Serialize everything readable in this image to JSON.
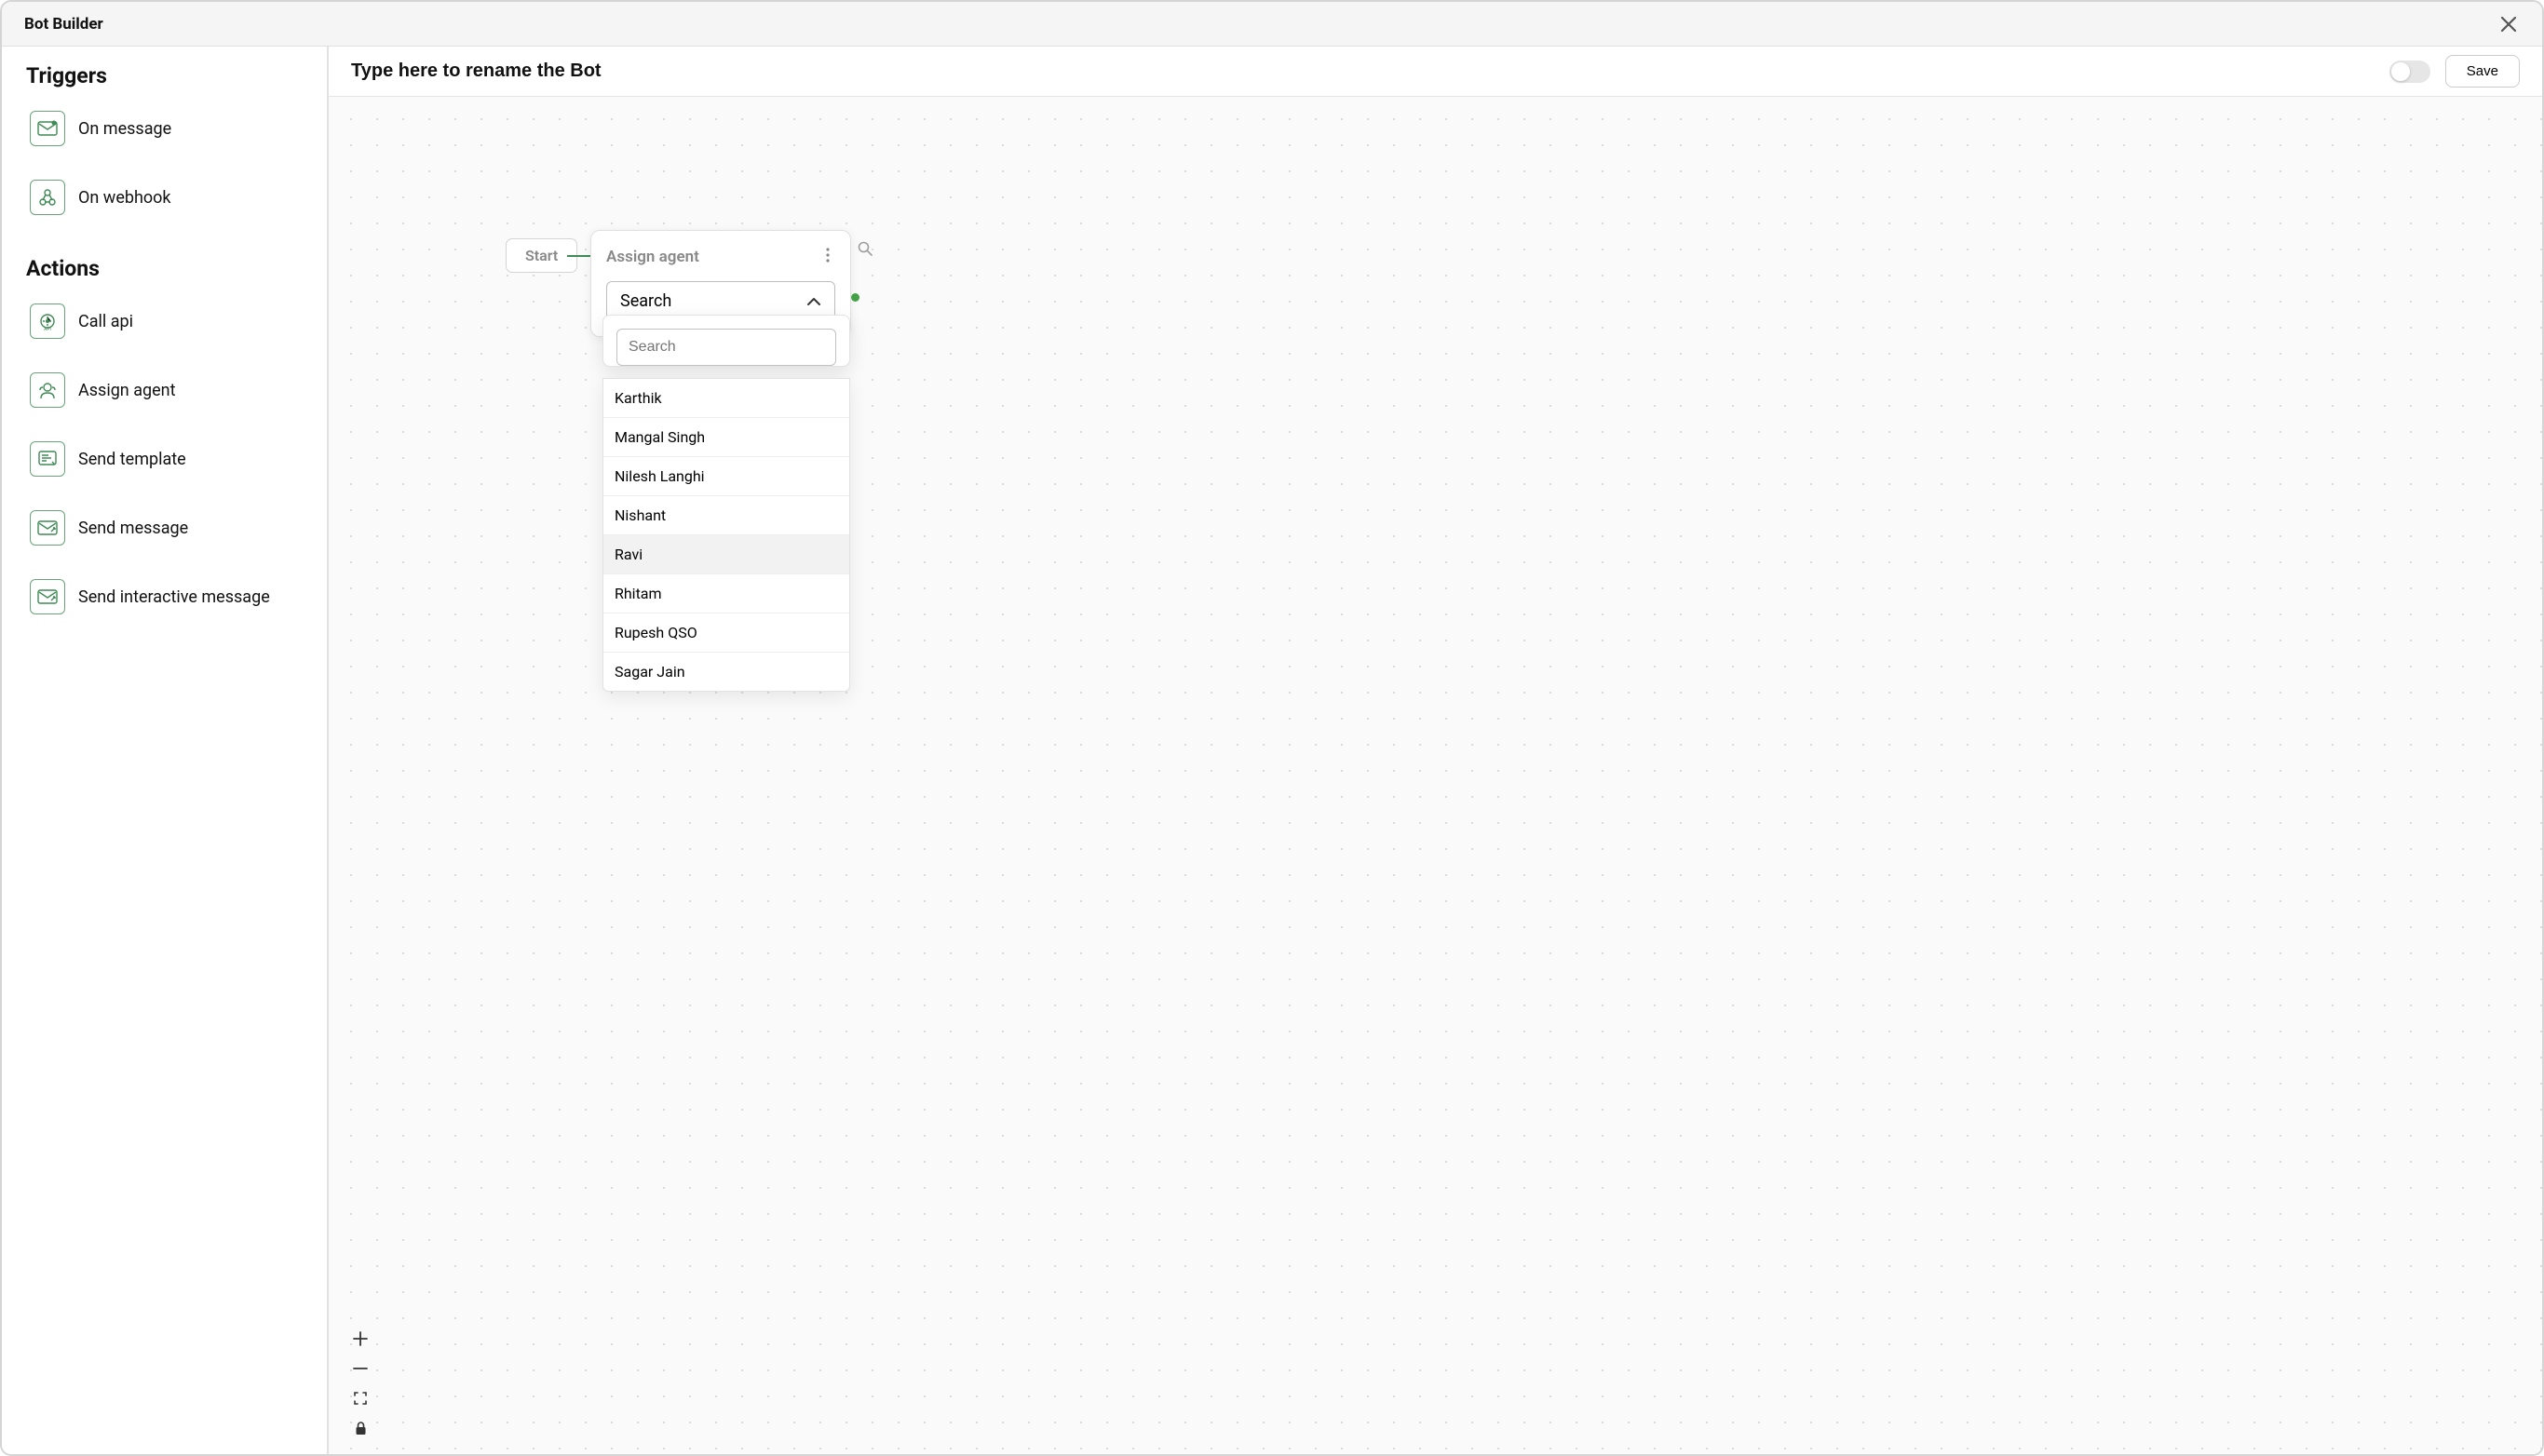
{
  "titlebar": {
    "title": "Bot Builder"
  },
  "sidebar": {
    "triggers_heading": "Triggers",
    "actions_heading": "Actions",
    "triggers": [
      {
        "label": "On message"
      },
      {
        "label": "On webhook"
      }
    ],
    "actions": [
      {
        "label": "Call api"
      },
      {
        "label": "Assign agent"
      },
      {
        "label": "Send template"
      },
      {
        "label": "Send message"
      },
      {
        "label": "Send interactive message"
      }
    ]
  },
  "toolbar": {
    "bot_name_placeholder": "Type here to rename the Bot",
    "save_label": "Save"
  },
  "canvas": {
    "start_label": "Start",
    "node": {
      "title": "Assign agent",
      "select_label": "Search"
    },
    "dropdown": {
      "search_placeholder": "Search",
      "options": [
        "Karthik",
        "Mangal Singh",
        "Nilesh Langhi",
        "Nishant",
        "Ravi",
        "Rhitam",
        "Rupesh QSO",
        "Sagar Jain"
      ],
      "highlighted_index": 4
    }
  }
}
